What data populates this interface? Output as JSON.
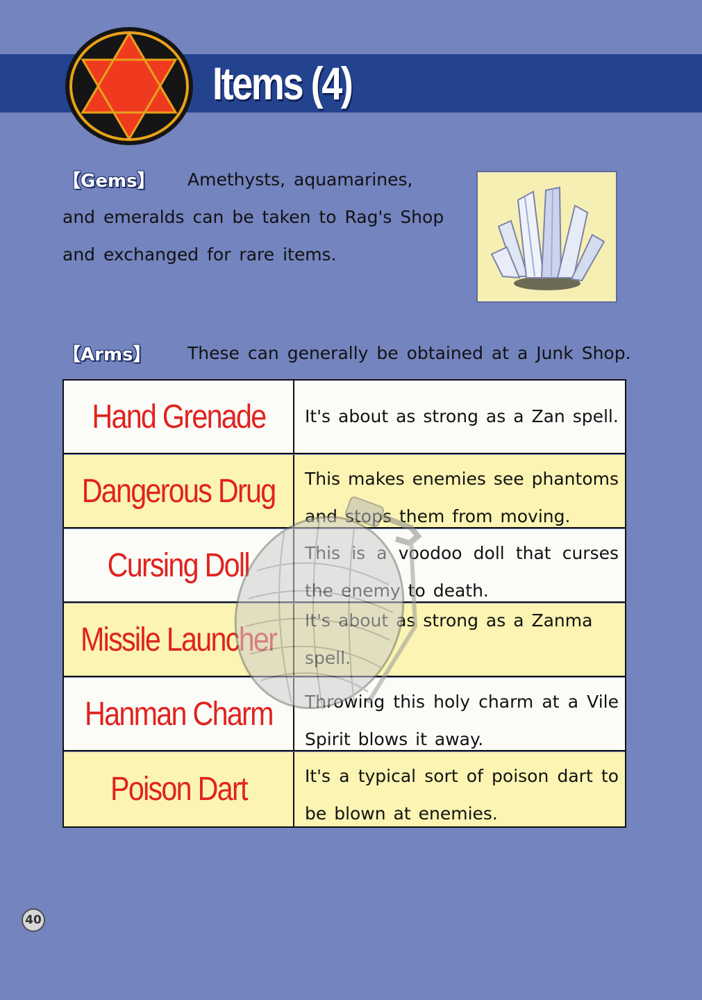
{
  "header": {
    "title": "Items (4)",
    "emblem": "hexagram-emblem-icon"
  },
  "gems": {
    "tag": "【Gems】",
    "lines": [
      "Amethysts, aquamarines,",
      "and emeralds can be taken to Rag's Shop",
      "and exchanged for rare items."
    ],
    "image": "crystal-gem-icon"
  },
  "arms": {
    "tag": "【Arms】",
    "intro": "These can generally be obtained at a Junk Shop.",
    "items": [
      {
        "name": "Hand Grenade",
        "desc": "It's about as strong as a Zan spell."
      },
      {
        "name": "Dangerous Drug",
        "desc": "This makes enemies see phantoms and stops them from moving."
      },
      {
        "name": "Cursing Doll",
        "desc": "This is a voodoo doll that curses the enemy to death."
      },
      {
        "name": "Missile Launcher",
        "desc": "It's about as strong as a Zanma spell."
      },
      {
        "name": "Hanman Charm",
        "desc": "Throwing this holy charm at a Vile Spirit blows it away."
      },
      {
        "name": "Poison Dart",
        "desc": "It's a typical sort of poison dart to be blown at enemies."
      }
    ],
    "background_image": "hand-grenade-icon"
  },
  "page": {
    "number": "40"
  },
  "colors": {
    "background": "#7384bf",
    "banner": "#24438f",
    "item_name": "#e0231e",
    "row_yellow": "#fbf4b2"
  }
}
